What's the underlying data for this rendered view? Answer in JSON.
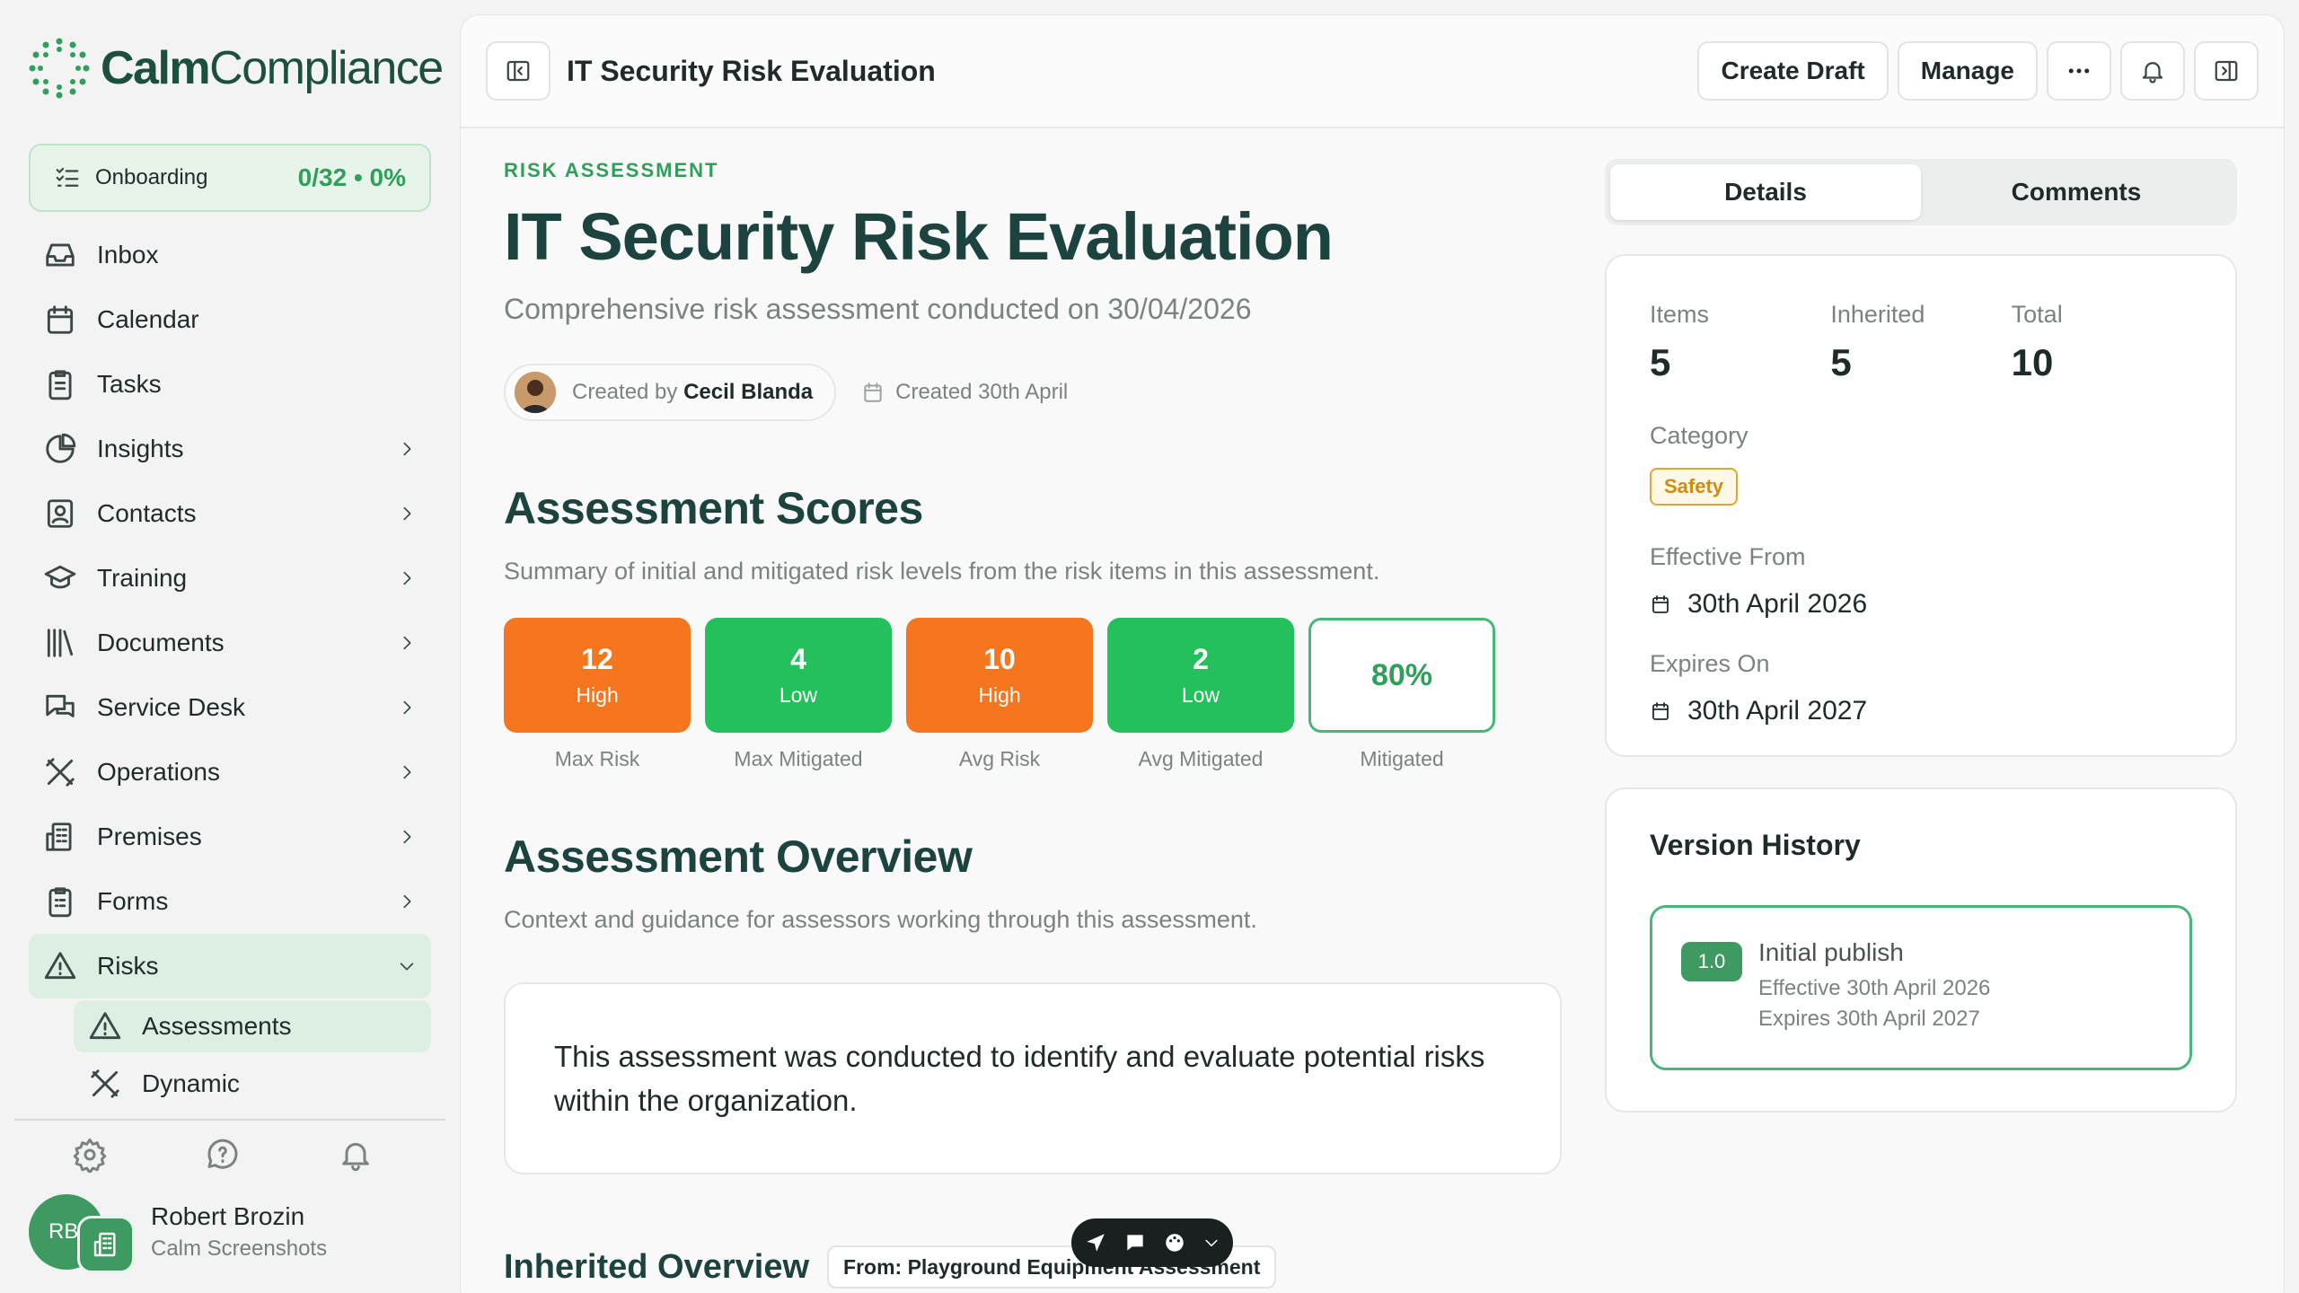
{
  "brand": {
    "name_bold": "Calm",
    "name_light": "Compliance",
    "accent": "#2f9f5a"
  },
  "onboarding": {
    "label": "Onboarding",
    "progress": "0/32 • 0%"
  },
  "nav": [
    {
      "label": "Inbox",
      "icon": "inbox-icon"
    },
    {
      "label": "Calendar",
      "icon": "calendar-icon"
    },
    {
      "label": "Tasks",
      "icon": "clipboard-icon"
    },
    {
      "label": "Insights",
      "icon": "pie-chart-icon"
    },
    {
      "label": "Contacts",
      "icon": "contact-book-icon"
    },
    {
      "label": "Training",
      "icon": "graduation-cap-icon"
    },
    {
      "label": "Documents",
      "icon": "library-icon"
    },
    {
      "label": "Service Desk",
      "icon": "chat-bubbles-icon"
    },
    {
      "label": "Operations",
      "icon": "tools-icon"
    },
    {
      "label": "Premises",
      "icon": "building-icon"
    },
    {
      "label": "Forms",
      "icon": "form-icon"
    },
    {
      "label": "Risks",
      "icon": "warning-icon"
    }
  ],
  "subnav": [
    {
      "label": "Assessments",
      "icon": "warning-icon"
    },
    {
      "label": "Dynamic",
      "icon": "tools-icon"
    }
  ],
  "user": {
    "initials": "RB",
    "name": "Robert Brozin",
    "org": "Calm Screenshots"
  },
  "topbar": {
    "title": "IT Security Risk Evaluation",
    "create_draft": "Create Draft",
    "manage": "Manage"
  },
  "page": {
    "eyebrow": "RISK ASSESSMENT",
    "title": "IT Security Risk Evaluation",
    "subtitle": "Comprehensive risk assessment conducted on 30/04/2026",
    "created_by_prefix": "Created by",
    "created_by_name": "Cecil Blanda",
    "created_date": "Created 30th April"
  },
  "scores_section": {
    "title": "Assessment Scores",
    "description": "Summary of initial and mitigated risk levels from the risk items in this assessment.",
    "items": [
      {
        "value": "12",
        "level": "High",
        "caption": "Max Risk",
        "color": "#f5761e"
      },
      {
        "value": "4",
        "level": "Low",
        "caption": "Max Mitigated",
        "color": "#23c05b"
      },
      {
        "value": "10",
        "level": "High",
        "caption": "Avg Risk",
        "color": "#f5761e"
      },
      {
        "value": "2",
        "level": "Low",
        "caption": "Avg Mitigated",
        "color": "#23c05b"
      }
    ],
    "mitigated": {
      "value": "80%",
      "caption": "Mitigated"
    }
  },
  "overview": {
    "title": "Assessment Overview",
    "description": "Context and guidance for assessors working through this assessment.",
    "body": "This assessment was conducted to identify and evaluate potential risks within the organization."
  },
  "inherited": {
    "title": "Inherited Overview",
    "tag": "From: Playground Equipment Assessment"
  },
  "tabs": {
    "details": "Details",
    "comments": "Comments"
  },
  "details": {
    "items_label": "Items",
    "items_value": "5",
    "inherited_label": "Inherited",
    "inherited_value": "5",
    "total_label": "Total",
    "total_value": "10",
    "category_label": "Category",
    "category_value": "Safety",
    "effective_label": "Effective From",
    "effective_value": "30th April 2026",
    "expires_label": "Expires On",
    "expires_value": "30th April 2027"
  },
  "version_history": {
    "title": "Version History",
    "version": "1.0",
    "name": "Initial publish",
    "effective": "Effective 30th April 2026",
    "expires": "Expires 30th April 2027"
  }
}
